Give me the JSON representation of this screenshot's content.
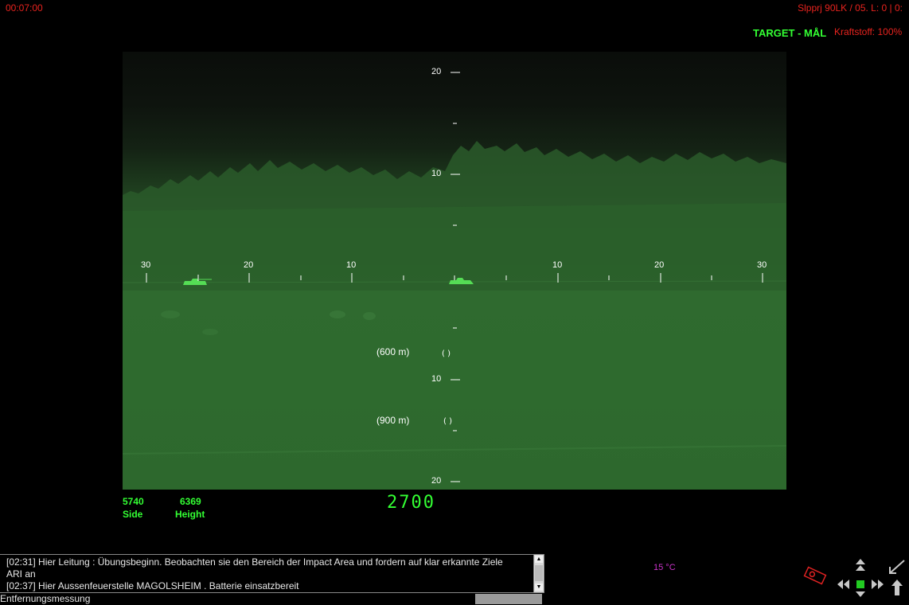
{
  "hud": {
    "clock": "00:07:00",
    "unit_info": "Slpprj 90LK / 05. L: 0 | 0:",
    "mode": "TARGET  -  MÅL",
    "fuel": "Kraftstoff: 100%"
  },
  "sight": {
    "scale_labels_v": [
      "20",
      "10",
      "10",
      "20"
    ],
    "scale_labels_h": [
      "30",
      "20",
      "10",
      "10",
      "20",
      "30"
    ],
    "range_marks": [
      "(600 m)",
      "(900 m)"
    ],
    "colors": {
      "phosphor": "#33ff33",
      "night_green": "#2e6a2e"
    }
  },
  "stats": {
    "side_value": "5740",
    "side_label": "Side",
    "height_value": "6369",
    "height_label": "Height",
    "readout": "2700"
  },
  "messages": {
    "lines": [
      "[02:31] Hier Leitung : Übungsbeginn. Beobachten sie den Bereich der Impact Area und fordern auf klar erkannte Ziele",
      "ARI an",
      "[02:37] Hier Aussenfeuerstelle  MAGOLSHEIM . Batterie einsatzbereit"
    ],
    "status": "Entfernungsmessung"
  },
  "temperature": "15 °C",
  "icons": [
    "vehicle-icon",
    "move-arrows-icon",
    "pointer-icon"
  ]
}
